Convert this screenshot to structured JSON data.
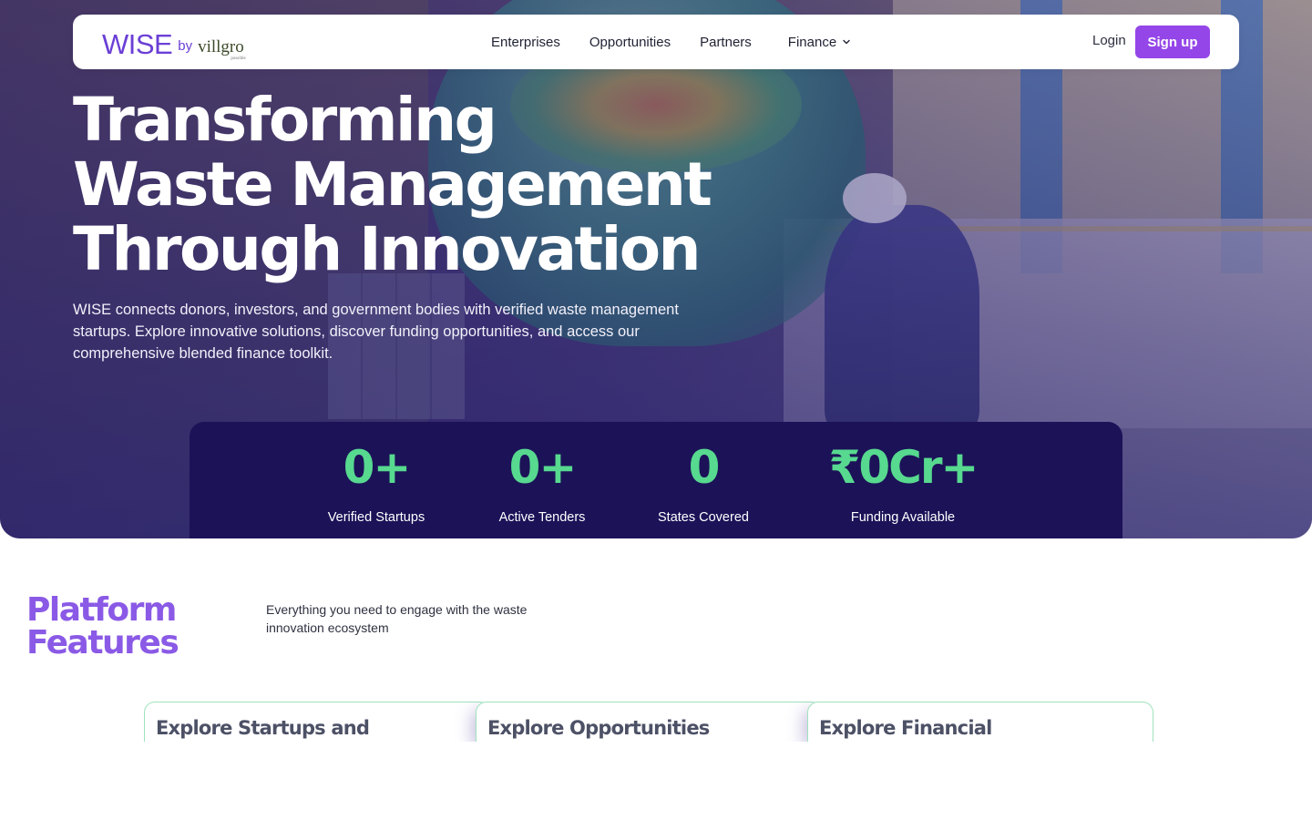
{
  "brand": {
    "name": "WISE",
    "by": "by",
    "partner": "villgro",
    "partner_tagline": "possible"
  },
  "nav": {
    "links": [
      "Enterprises",
      "Opportunities",
      "Partners"
    ],
    "finance_label": "Finance",
    "login_label": "Login",
    "signup_label": "Sign up"
  },
  "hero": {
    "title_lines": [
      "Transforming",
      "Waste Management",
      "Through Innovation"
    ],
    "description": "WISE connects donors, investors, and government bodies with verified waste management startups. Explore innovative solutions, discover funding opportunities, and access our comprehensive blended finance toolkit."
  },
  "stats": [
    {
      "value": "0+",
      "label": "Verified Startups"
    },
    {
      "value": "0+",
      "label": "Active Tenders"
    },
    {
      "value": "0",
      "label": "States Covered"
    },
    {
      "value": "₹0Cr+",
      "label": "Funding Available"
    }
  ],
  "features": {
    "title_lines": [
      "Platform",
      "Features"
    ],
    "subtitle": "Everything you need to engage with the waste innovation ecosystem",
    "cards": [
      {
        "title": "Explore Startups and"
      },
      {
        "title": "Explore Opportunities"
      },
      {
        "title": "Explore Financial"
      }
    ]
  },
  "colors": {
    "brand_purple": "#9446e8",
    "stat_green": "#57d98f",
    "stats_bg": "#1c1258",
    "features_purple": "#8a5ae6"
  }
}
